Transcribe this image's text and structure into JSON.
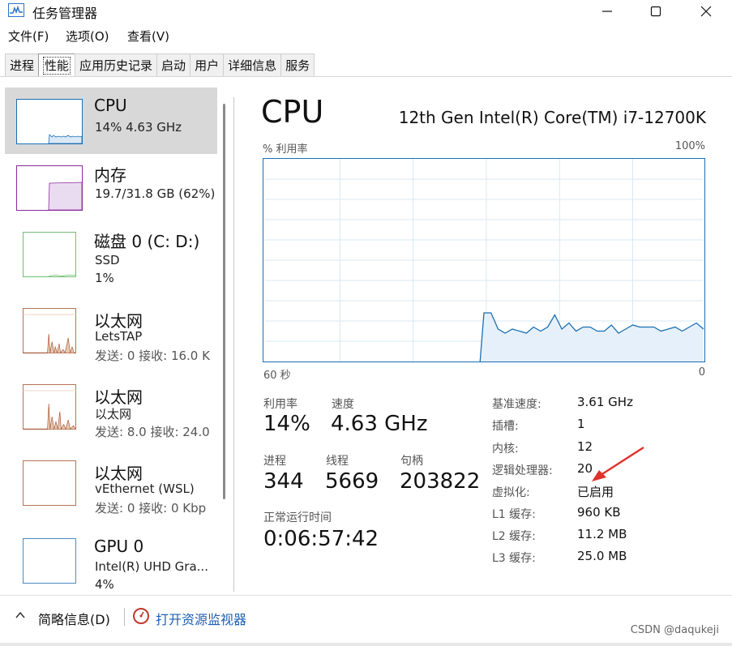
{
  "window": {
    "title": "任务管理器",
    "controls": {
      "minimize": "—",
      "maximize": "☐",
      "close": "✕"
    }
  },
  "menu": [
    "文件(F)",
    "选项(O)",
    "查看(V)"
  ],
  "tabs": [
    {
      "label": "进程",
      "active": false
    },
    {
      "label": "性能",
      "active": true
    },
    {
      "label": "应用历史记录",
      "active": false
    },
    {
      "label": "启动",
      "active": false
    },
    {
      "label": "用户",
      "active": false
    },
    {
      "label": "详细信息",
      "active": false
    },
    {
      "label": "服务",
      "active": false
    }
  ],
  "resources": [
    {
      "name": "CPU",
      "sub1": "14% 4.63 GHz",
      "sub2": "",
      "color": "#1a6fb3",
      "selected": true
    },
    {
      "name": "内存",
      "sub1": "19.7/31.8 GB (62%)",
      "sub2": "",
      "color": "#8b2a9e",
      "selected": false
    },
    {
      "name": "磁盘 0 (C: D:)",
      "sub1": "SSD",
      "sub2": "1%",
      "color": "#4caf50",
      "selected": false
    },
    {
      "name": "以太网",
      "sub1": "LetsTAP",
      "sub2": "发送: 0 接收: 16.0 K",
      "color": "#a0522d",
      "selected": false
    },
    {
      "name": "以太网",
      "sub1": "以太网",
      "sub2": "发送: 8.0 接收: 24.0",
      "color": "#a0522d",
      "selected": false
    },
    {
      "name": "以太网",
      "sub1": "vEthernet (WSL)",
      "sub2": "发送: 0 接收: 0 Kbp",
      "color": "#a0522d",
      "selected": false
    },
    {
      "name": "GPU 0",
      "sub1": "Intel(R) UHD Gra...",
      "sub2": "4%",
      "color": "#1a6fb3",
      "selected": false
    }
  ],
  "cpu": {
    "title": "CPU",
    "model": "12th Gen Intel(R) Core(TM) i7-12700K",
    "graph_label": "% 利用率",
    "graph_max": "100%",
    "axis_left": "60 秒",
    "axis_right": "0",
    "utilization_history_percent": [
      0,
      0,
      0,
      0,
      0,
      0,
      0,
      0,
      0,
      0,
      0,
      0,
      0,
      0,
      0,
      0,
      0,
      0,
      0,
      0,
      0,
      0,
      0,
      0,
      0,
      0,
      0,
      0,
      0,
      0,
      0,
      24,
      24,
      16,
      14,
      16,
      15,
      14,
      17,
      15,
      17,
      23,
      16,
      19,
      15,
      17,
      17,
      15,
      15,
      18,
      14,
      16,
      18,
      17,
      17,
      17,
      15,
      16,
      17,
      15,
      17,
      19,
      16
    ],
    "stats": {
      "utilization_label": "利用率",
      "utilization": "14%",
      "speed_label": "速度",
      "speed": "4.63 GHz",
      "processes_label": "进程",
      "processes": "344",
      "threads_label": "线程",
      "threads": "5669",
      "handles_label": "句柄",
      "handles": "203822",
      "uptime_label": "正常运行时间",
      "uptime": "0:06:57:42"
    },
    "specs": [
      {
        "label": "基准速度:",
        "value": "3.61 GHz"
      },
      {
        "label": "插槽:",
        "value": "1"
      },
      {
        "label": "内核:",
        "value": "12"
      },
      {
        "label": "逻辑处理器:",
        "value": "20"
      },
      {
        "label": "虚拟化:",
        "value": "已启用"
      },
      {
        "label": "L1 缓存:",
        "value": "960 KB"
      },
      {
        "label": "L2 缓存:",
        "value": "11.2 MB"
      },
      {
        "label": "L3 缓存:",
        "value": "25.0 MB"
      }
    ]
  },
  "footer": {
    "brief": "简略信息(D)",
    "monitor_link": "打开资源监视器",
    "watermark": "CSDN @daqukeji"
  },
  "colors": {
    "accent": "#1a6fb3",
    "arrow": "#e0322b",
    "link": "#1e5fb4"
  }
}
